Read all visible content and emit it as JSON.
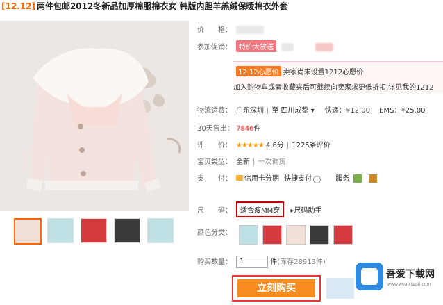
{
  "title": {
    "tag": "[12.12]",
    "text": "两件包邮2012冬新品加厚棉服棉衣女 韩版内胆羊羔绒保暖棉衣外套"
  },
  "fields": {
    "price_label": "价　　格：",
    "promo_label": "参加促销：",
    "promo_tag": "特价大放送",
    "promo_chip": "12.12心愿价",
    "promo_line1": "卖家尚未设置1212心愿价",
    "promo_line2": "加入购物车或者收藏夹后可继续向卖家求更低折扣,详见我的1212",
    "shipping_label": "物流运费：",
    "shipping_from": "广东深圳",
    "shipping_to": "四川成都",
    "express": "快递：",
    "express_price": "12.00",
    "ems": "EMS：",
    "ems_price": "25.00",
    "sold_label": "30天售出：",
    "sold_count": "7846",
    "sold_unit": "件",
    "rating_label": "评　　价：",
    "rating_stars": "★★★★★",
    "rating_value": "4.6分",
    "review_count": "1225条评价",
    "type_label": "宝贝类型：",
    "type_new": "全新",
    "type_bid": "一次调货",
    "pay_label": "支　　付：",
    "pay_card": "信用卡分期",
    "pay_fast": "快捷支付",
    "service_label": "服务",
    "size_label": "尺　　码：",
    "size_value": "适合瘦MM穿",
    "size_help": "尺码助手",
    "color_label": "颜色分类：",
    "qty_label": "购买数量：",
    "qty_value": "1",
    "qty_unit": "件",
    "stock": "(库存28913件)",
    "buy_button": "立刻购买",
    "rmb": "¥"
  },
  "watermark": {
    "name": "吾爱下载网",
    "url": "www.wuaixiazai.com"
  },
  "colors": {
    "accent": "#f60",
    "buy_button": "#f68c1f",
    "promo_tag": "#f3767e"
  }
}
